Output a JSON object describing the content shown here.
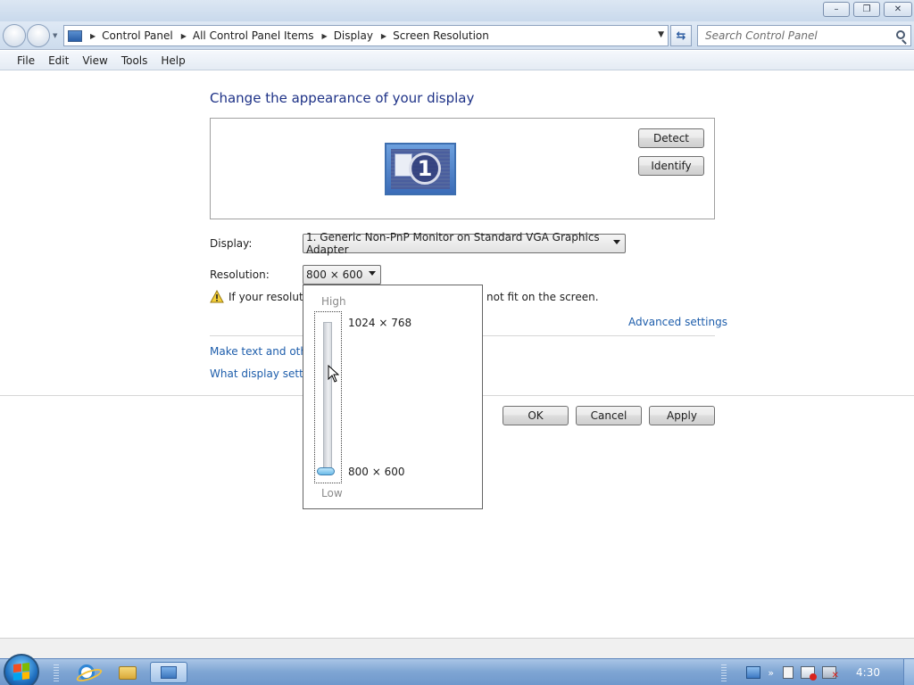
{
  "window": {
    "controls": {
      "minimize": "–",
      "maximize": "❐",
      "close": "✕"
    }
  },
  "address_bar": {
    "breadcrumbs": [
      "Control Panel",
      "All Control Panel Items",
      "Display",
      "Screen Resolution"
    ],
    "search_placeholder": "Search Control Panel"
  },
  "menu": [
    "File",
    "Edit",
    "View",
    "Tools",
    "Help"
  ],
  "main": {
    "heading": "Change the appearance of your display",
    "monitor_number": "1",
    "detect_label": "Detect",
    "identify_label": "Identify",
    "display_label": "Display:",
    "display_value": "1. Generic Non-PnP Monitor on Standard VGA Graphics Adapter",
    "resolution_label": "Resolution:",
    "resolution_value": "800 × 600",
    "warning_text_left": "If your resolutio",
    "warning_text_right": "not fit on the screen.",
    "advanced_settings": "Advanced settings",
    "link_text_size": "Make text and other",
    "link_display_settings": "What display setting",
    "ok_label": "OK",
    "cancel_label": "Cancel",
    "apply_label": "Apply"
  },
  "resolution_popup": {
    "high_label": "High",
    "low_label": "Low",
    "top_option": "1024 × 768",
    "bottom_option": "800 × 600",
    "slider_level": 0
  },
  "taskbar": {
    "clock": "4:30",
    "tray_expand": "»"
  },
  "colors": {
    "heading": "#1e3287",
    "link": "#1d5dab",
    "taskbar": "#7ea5d3"
  }
}
